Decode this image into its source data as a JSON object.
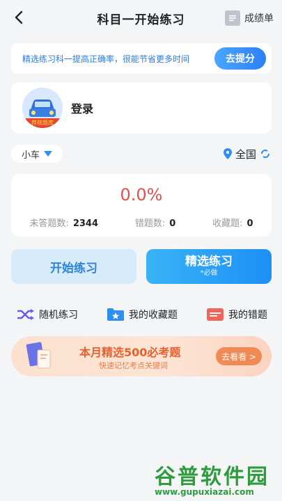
{
  "header": {
    "title": "科目一开始练习",
    "report_label": "成绩单"
  },
  "promo": {
    "text": "精选练习科一提高正确率，很能节省更多时间",
    "button_label": "去提分"
  },
  "login": {
    "label": "登录",
    "avatar_tag": "荐规题库"
  },
  "selectors": {
    "vehicle": "小车",
    "region": "全国"
  },
  "stats": {
    "accuracy": "0.0%",
    "unanswered_label": "未答题数:",
    "unanswered_value": "2344",
    "wrong_label": "错题数:",
    "wrong_value": "0",
    "favorite_label": "收藏题:",
    "favorite_value": "0"
  },
  "actions": {
    "start_label": "开始练习",
    "selected_label": "精选练习",
    "selected_sub": "*必做"
  },
  "quick_links": [
    {
      "label": "随机练习",
      "icon": "shuffle-icon"
    },
    {
      "label": "我的收藏题",
      "icon": "folder-star-icon"
    },
    {
      "label": "我的错题",
      "icon": "wrong-list-icon"
    }
  ],
  "ad": {
    "title": "本月精选500必考题",
    "subtitle": "快速记忆考点关键词",
    "button_label": "去看看 >"
  },
  "watermark": {
    "main": "谷普软件园",
    "sub": "www.gupuxiazai.com"
  },
  "colors": {
    "accent": "#2d7ff5",
    "rate": "#e0524c",
    "ad_orange": "#e8612f"
  }
}
